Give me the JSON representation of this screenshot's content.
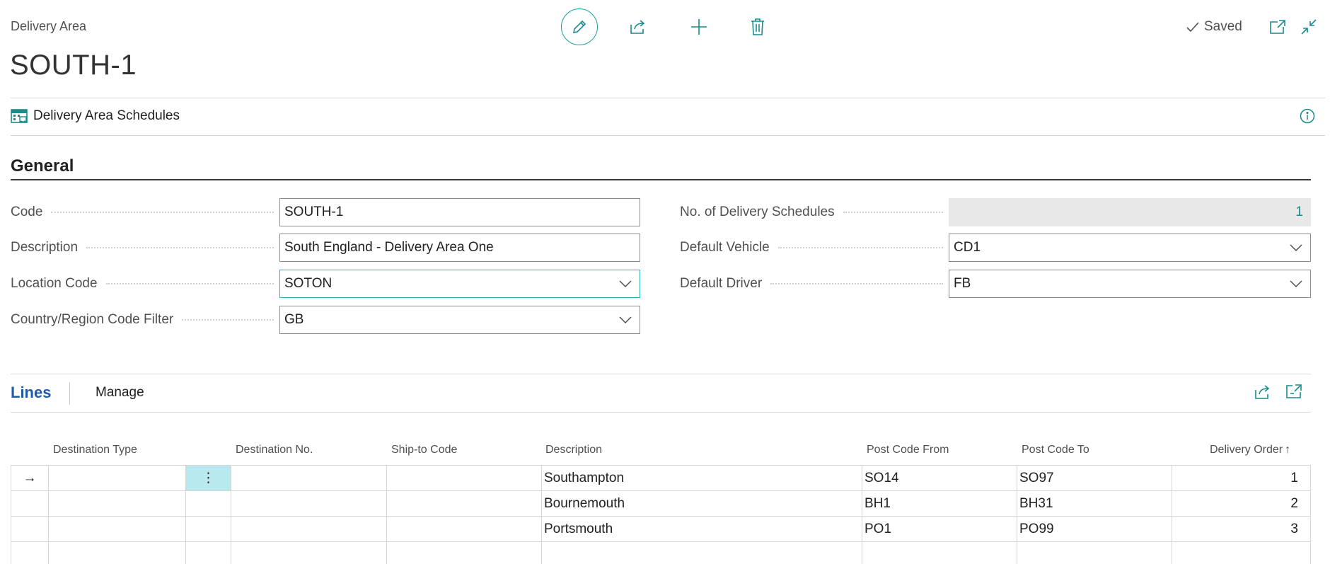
{
  "header": {
    "caption": "Delivery Area",
    "title": "SOUTH-1",
    "saved_label": "Saved"
  },
  "factbox": {
    "label": "Delivery Area Schedules"
  },
  "general": {
    "title": "General",
    "fields": {
      "code": {
        "label": "Code",
        "value": "SOUTH-1"
      },
      "description": {
        "label": "Description",
        "value": "South England - Delivery Area One"
      },
      "location_code": {
        "label": "Location Code",
        "value": "SOTON"
      },
      "country_filter": {
        "label": "Country/Region Code Filter",
        "value": "GB"
      },
      "no_schedules": {
        "label": "No. of Delivery Schedules",
        "value": "1"
      },
      "default_vehicle": {
        "label": "Default Vehicle",
        "value": "CD1"
      },
      "default_driver": {
        "label": "Default Driver",
        "value": "FB"
      }
    }
  },
  "lines": {
    "tab_label": "Lines",
    "manage_label": "Manage",
    "columns": {
      "destination_type": "Destination Type",
      "destination_no": "Destination No.",
      "ship_to_code": "Ship-to Code",
      "description": "Description",
      "post_code_from": "Post Code From",
      "post_code_to": "Post Code To",
      "delivery_order": "Delivery Order"
    },
    "sort_indicator": "↑",
    "current_row_indicator": "→",
    "row_menu_glyph": "⋮",
    "rows": [
      {
        "destination_type": "",
        "destination_no": "",
        "ship_to_code": "",
        "description": "Southampton",
        "post_code_from": "SO14",
        "post_code_to": "SO97",
        "delivery_order": "1"
      },
      {
        "destination_type": "",
        "destination_no": "",
        "ship_to_code": "",
        "description": "Bournemouth",
        "post_code_from": "BH1",
        "post_code_to": "BH31",
        "delivery_order": "2"
      },
      {
        "destination_type": "",
        "destination_no": "",
        "ship_to_code": "",
        "description": "Portsmouth",
        "post_code_from": "PO1",
        "post_code_to": "PO99",
        "delivery_order": "3"
      }
    ]
  },
  "icons": {
    "edit": "pencil-icon",
    "share": "share-icon",
    "new": "plus-icon",
    "delete": "trash-icon",
    "saved": "checkmark-icon",
    "open_new_window": "open-new-window-icon",
    "collapse": "collapse-icon",
    "factbox": "delivery-schedule-icon",
    "info": "info-icon",
    "dropdown": "chevron-down-icon",
    "lines_share": "share-icon",
    "lines_expand": "expand-icon"
  },
  "colors": {
    "accent": "#00a4a4",
    "tab_active": "#1f5aa6",
    "selected_cell": "#b8e9ef",
    "readonly_field": "#e8e8e8"
  }
}
